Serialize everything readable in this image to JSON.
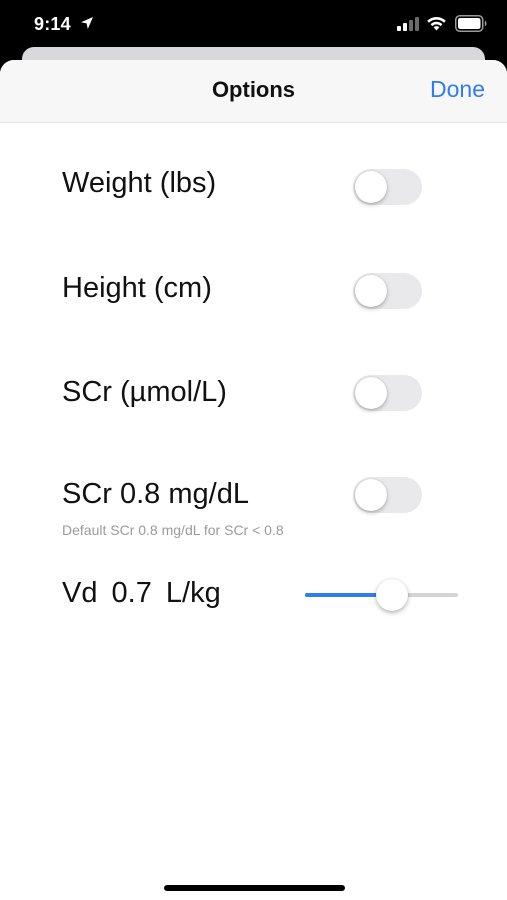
{
  "status_bar": {
    "time": "9:14",
    "icons": [
      "location-arrow-icon",
      "cellular-signal-icon",
      "wifi-icon",
      "battery-icon"
    ]
  },
  "nav": {
    "title": "Options",
    "done_label": "Done"
  },
  "options": [
    {
      "label": "Weight (lbs)",
      "enabled": false
    },
    {
      "label": "Height (cm)",
      "enabled": false
    },
    {
      "label": "SCr (µmol/L)",
      "enabled": false
    },
    {
      "label": "SCr 0.8 mg/dL",
      "enabled": false,
      "hint": "Default SCr 0.8 mg/dL for SCr < 0.8"
    }
  ],
  "vd": {
    "label": "Vd  0.7  L/kg",
    "value_fraction": 0.5
  },
  "colors": {
    "accent": "#2f7cf6",
    "toggle_off": "#e9e9eb",
    "nav_bg": "#f7f7f8",
    "hint": "#9a9aa0"
  }
}
